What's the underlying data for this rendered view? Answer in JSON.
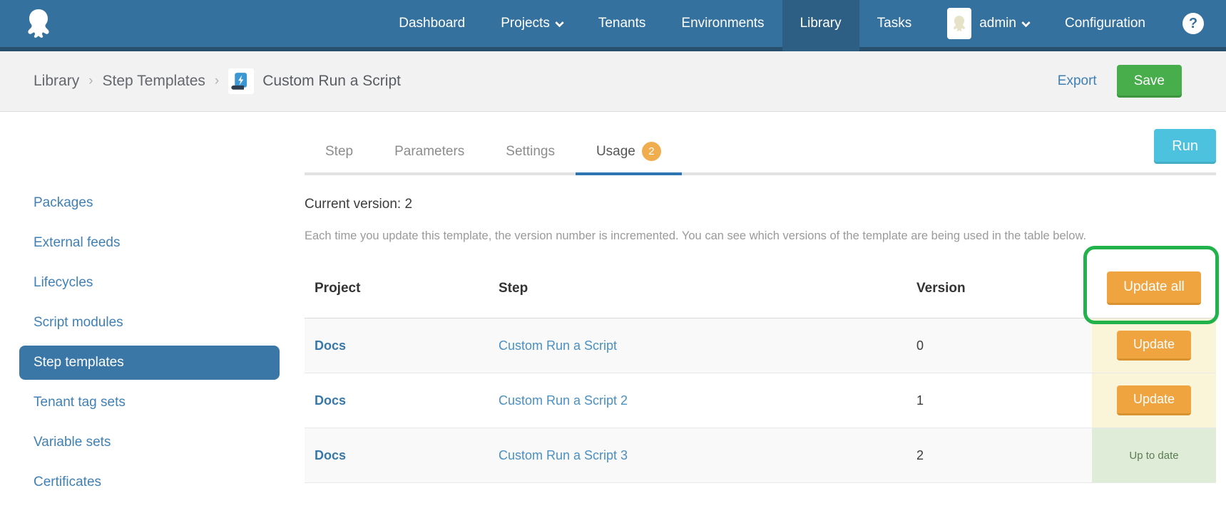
{
  "nav": {
    "items": [
      {
        "label": "Dashboard"
      },
      {
        "label": "Projects"
      },
      {
        "label": "Tenants"
      },
      {
        "label": "Environments"
      },
      {
        "label": "Library"
      },
      {
        "label": "Tasks"
      }
    ],
    "user": {
      "name": "admin"
    },
    "config_label": "Configuration",
    "help_glyph": "?"
  },
  "breadcrumb": {
    "segments": [
      "Library",
      "Step Templates"
    ],
    "separator": "›",
    "current": "Custom Run a Script"
  },
  "actions": {
    "export_label": "Export",
    "save_label": "Save",
    "run_label": "Run"
  },
  "sidebar": {
    "items": [
      {
        "label": "Packages"
      },
      {
        "label": "External feeds"
      },
      {
        "label": "Lifecycles"
      },
      {
        "label": "Script modules"
      },
      {
        "label": "Step templates"
      },
      {
        "label": "Tenant tag sets"
      },
      {
        "label": "Variable sets"
      },
      {
        "label": "Certificates"
      }
    ]
  },
  "tabs": [
    {
      "label": "Step"
    },
    {
      "label": "Parameters"
    },
    {
      "label": "Settings"
    },
    {
      "label": "Usage",
      "badge": "2"
    }
  ],
  "usage": {
    "current_version": "Current version: 2",
    "description": "Each time you update this template, the version number is incremented. You can see which versions of the template are being used in the table below.",
    "table": {
      "headers": [
        "Project",
        "Step",
        "Version"
      ],
      "update_all_label": "Update all",
      "rows": [
        {
          "project": "Docs",
          "step": "Custom Run a Script",
          "version": "0",
          "action": "Update"
        },
        {
          "project": "Docs",
          "step": "Custom Run a Script 2",
          "version": "1",
          "action": "Update"
        },
        {
          "project": "Docs",
          "step": "Custom Run a Script 3",
          "version": "2",
          "action": "Up to date"
        }
      ]
    }
  },
  "colors": {
    "nav_blue": "#35719e",
    "nav_active": "#2d5e84",
    "save_green": "#47ae4b",
    "run_cyan": "#4cc2de",
    "update_orange": "#f0a440",
    "badge_orange": "#f0ad4e",
    "annotation_green": "#22b24c",
    "action_cell_yellow": "#faf5d8",
    "action_cell_green": "#deecd8"
  }
}
